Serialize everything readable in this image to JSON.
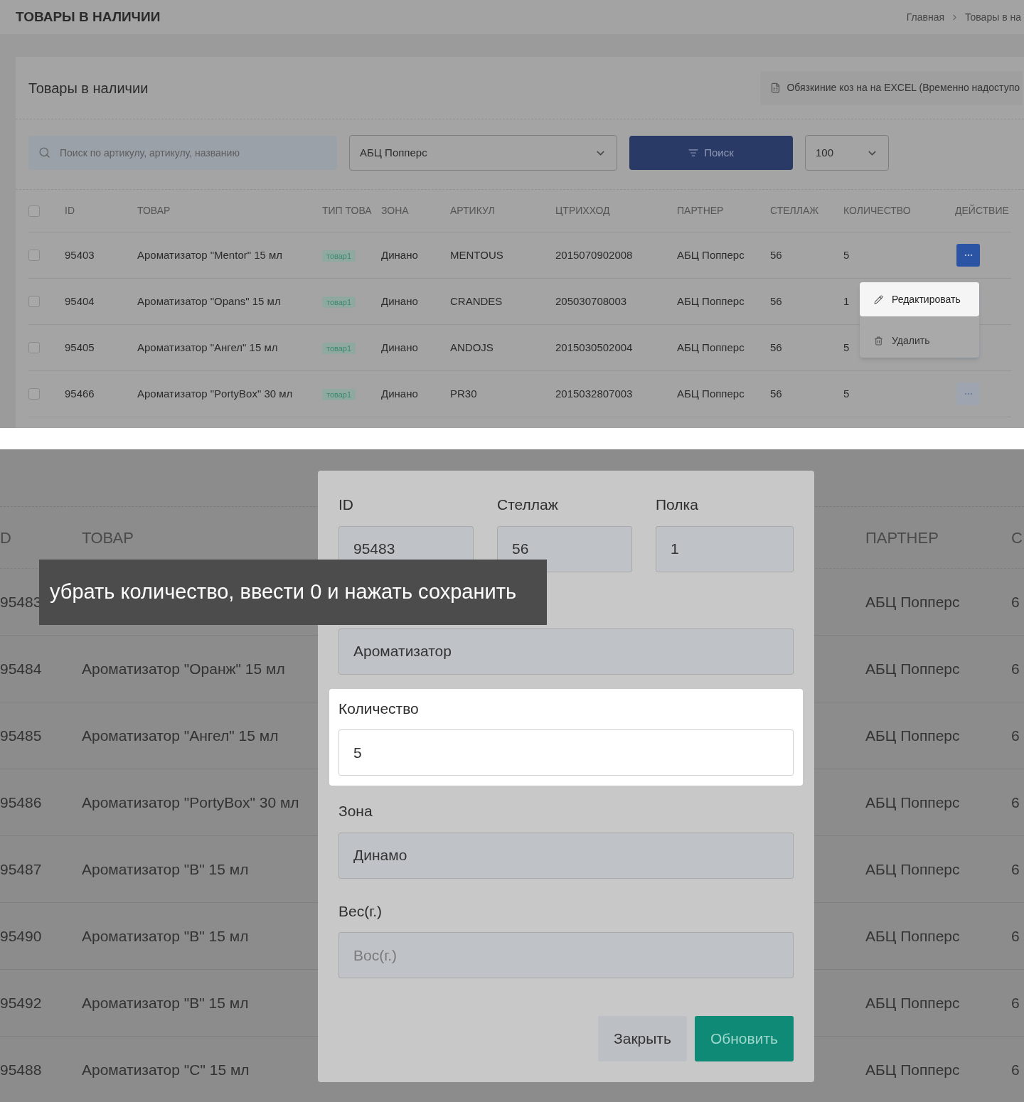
{
  "header": {
    "title": "ТОВАРЫ В НАЛИЧИИ",
    "breadcrumb": [
      "Главная",
      "Товары в на"
    ]
  },
  "card": {
    "title": "Товары в наличии",
    "export_button": "Обязкиние коз на на EXCEL (Временно надоступо",
    "search": {
      "placeholder": "Поиск по артикулу, артикулу, названию"
    },
    "partner_select": {
      "value": "АБЦ Попперс"
    },
    "search_button": "Поиск",
    "per_page": {
      "value": "100"
    }
  },
  "table": {
    "header_checked": false,
    "columns": [
      "ID",
      "ТОВАР",
      "ТИП ТОВА",
      "ЗОНА",
      "АРТИКУЛ",
      "ЦТРИХХОД",
      "ПАРТНЕР",
      "СТЕЛЛАЖ",
      "КОЛИЧЕСТВО",
      "ДЕЙСТВИЕ"
    ],
    "rows": [
      {
        "checked": false,
        "id": "95403",
        "product": "Ароматизатор \"Mentor\" 15 мл",
        "type": "товар1",
        "zone": "Динано",
        "article": "MENTOUS",
        "barcode": "2015070902008",
        "partner": "АБЦ Попперс",
        "rack": "56",
        "quantity": "5",
        "menu_open": true
      },
      {
        "checked": false,
        "id": "95404",
        "product": "Ароматизатор \"Opans\" 15 мл",
        "type": "товар1",
        "zone": "Динано",
        "article": "CRANDES",
        "barcode": "205030708003",
        "partner": "АБЦ Попперс",
        "rack": "56",
        "quantity": "1",
        "menu_open": false
      },
      {
        "checked": false,
        "id": "95405",
        "product": "Ароматизатор \"Ангел\" 15 мл",
        "type": "товар1",
        "zone": "Динано",
        "article": "ANDOJS",
        "barcode": "2015030502004",
        "partner": "АБЦ Попперс",
        "rack": "56",
        "quantity": "5",
        "menu_open": false
      },
      {
        "checked": false,
        "id": "95466",
        "product": "Ароматизатор \"PortyBox\" 30 мл",
        "type": "товар1",
        "zone": "Динано",
        "article": "PR30",
        "barcode": "2015032807003",
        "partner": "АБЦ Попперс",
        "rack": "56",
        "quantity": "5",
        "menu_open": false
      }
    ]
  },
  "action_menu": {
    "items": [
      {
        "kind": "edit",
        "label": "Редактировать",
        "selected": true
      },
      {
        "kind": "delete",
        "label": "Удалить",
        "selected": false
      }
    ]
  },
  "background_table": {
    "columns": [
      "D",
      "ТОВАР",
      "ПАРТНЕР",
      "С"
    ],
    "rows": [
      {
        "id": "95483",
        "partner": "АБЦ Попперс",
        "column_4": "6"
      },
      {
        "id": "95484",
        "product": "Ароматизатор \"Оранж\" 15 мл",
        "partner": "АБЦ Попперс",
        "column_4": "6"
      },
      {
        "id": "95485",
        "product": "Ароматизатор \"Ангел\" 15 мл",
        "partner": "АБЦ Попперс",
        "column_4": "6"
      },
      {
        "id": "95486",
        "product": "Ароматизатор \"PortyBox\" 30 мл",
        "partner": "АБЦ Попперс",
        "column_4": "6"
      },
      {
        "id": "95487",
        "product": "Ароматизатор \"B\" 15 мл",
        "partner": "АБЦ Попперс",
        "column_4": "6"
      },
      {
        "id": "95490",
        "product": "Ароматизатор \"B\" 15 мл",
        "partner": "АБЦ Попперс",
        "column_4": "6"
      },
      {
        "id": "95492",
        "product": "Ароматизатор \"B\" 15 мл",
        "partner": "АБЦ Попперс",
        "column_4": "6"
      },
      {
        "id": "95488",
        "product": "Ароматизатор \"C\" 15 мл",
        "partner": "АБЦ Попперс",
        "column_4": "6"
      }
    ]
  },
  "modal": {
    "top_fields": [
      {
        "label": "ID",
        "value": "95483"
      },
      {
        "label": "Стеллаж",
        "value": "56"
      },
      {
        "label": "Полка",
        "value": "1"
      }
    ],
    "fields": [
      {
        "value": "Ароматизатор",
        "highlighted": false
      },
      {
        "label": "Количество",
        "value": "5",
        "highlighted": true
      },
      {
        "label": "Зона",
        "value": "Динамо",
        "highlighted": false
      },
      {
        "label": "Вес(г.)",
        "placeholder": "Вос(г.)",
        "highlighted": false
      }
    ],
    "buttons": [
      {
        "kind": "secondary",
        "label": "Закрыть"
      },
      {
        "kind": "primary",
        "label": "Обновить"
      }
    ]
  },
  "caption": "убрать количество, ввести 0 и нажать сохранить"
}
